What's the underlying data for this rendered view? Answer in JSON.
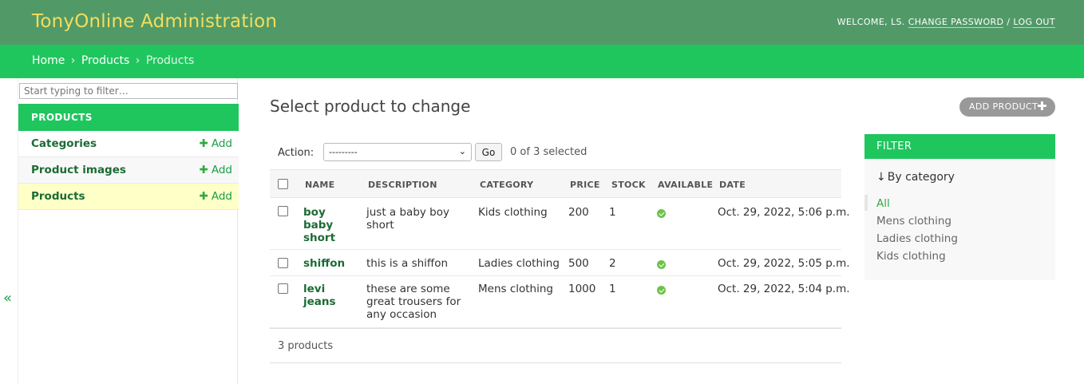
{
  "header": {
    "site_title": "TonyOnline Administration",
    "welcome": "WELCOME, ",
    "user": "LS",
    "change_password": "CHANGE PASSWORD",
    "separator": " / ",
    "log_out": "LOG OUT"
  },
  "breadcrumbs": {
    "home": "Home",
    "sep": "›",
    "app": "Products",
    "current": "Products"
  },
  "sidebar": {
    "filter_placeholder": "Start typing to filter…",
    "module_caption": "PRODUCTS",
    "add_label": "Add",
    "models": [
      {
        "name": "Categories"
      },
      {
        "name": "Product images"
      },
      {
        "name": "Products"
      }
    ],
    "collapse_glyph": "«"
  },
  "content": {
    "title": "Select product to change",
    "add_button": "ADD PRODUCT",
    "action_label": "Action:",
    "action_selected": "---------",
    "go_label": "Go",
    "selection_count": "0 of 3 selected",
    "columns": [
      "NAME",
      "DESCRIPTION",
      "CATEGORY",
      "PRICE",
      "STOCK",
      "AVAILABLE",
      "DATE"
    ],
    "rows": [
      {
        "name": "boy baby short",
        "description": "just a baby boy short",
        "category": "Kids clothing",
        "price": "200",
        "stock": "1",
        "available": true,
        "date": "Oct. 29, 2022, 5:06 p.m."
      },
      {
        "name": "shiffon",
        "description": "this is a shiffon",
        "category": "Ladies clothing",
        "price": "500",
        "stock": "2",
        "available": true,
        "date": "Oct. 29, 2022, 5:05 p.m."
      },
      {
        "name": "levi jeans",
        "description": "these are some great trousers for any occasion",
        "category": "Mens clothing",
        "price": "1000",
        "stock": "1",
        "available": true,
        "date": "Oct. 29, 2022, 5:04 p.m."
      }
    ],
    "paginator": "3 products"
  },
  "filter": {
    "caption": "FILTER",
    "heading_arrow": "↓",
    "heading": "By category",
    "options": [
      "All",
      "Mens clothing",
      "Ladies clothing",
      "Kids clothing"
    ],
    "selected_index": 0
  },
  "colors": {
    "header_bg": "#519a67",
    "accent": "#1fc65e",
    "title_yellow": "#f5dd5d",
    "link_green": "#1b6b34",
    "selected_row": "#ffffc8"
  },
  "icons": {
    "add": "plus-icon",
    "available": "check-circle-icon",
    "select_caret": "chevron-down-icon",
    "collapse": "double-chevron-left-icon"
  }
}
